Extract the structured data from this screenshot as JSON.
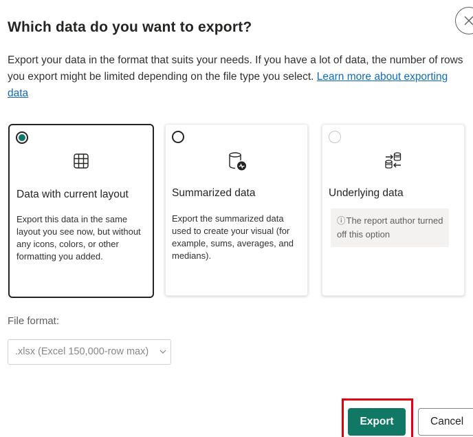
{
  "dialog": {
    "title": "Which data do you want to export?",
    "close_icon": "close-icon",
    "description": "Export your data in the format that suits your needs. If you have a lot of data, the number of rows you export might be limited depending on the file type you select.",
    "learn_more_link": "Learn more about exporting data"
  },
  "options": [
    {
      "title": "Data with current layout",
      "description": "Export this data in the same layout you see now, but without any icons, colors, or other formatting you added.",
      "icon": "table-grid-icon",
      "selected": true
    },
    {
      "title": "Summarized data",
      "description": "Export the summarized data used to create your visual (for example, sums, averages, and medians).",
      "icon": "database-chart-icon",
      "selected": false
    },
    {
      "title": "Underlying data",
      "note": "The report author turned off this option",
      "icon": "database-arrows-icon",
      "selected": false,
      "disabled": true
    }
  ],
  "file_format": {
    "label": "File format:",
    "value": ".xlsx (Excel 150,000-row max)"
  },
  "buttons": {
    "export": "Export",
    "cancel": "Cancel"
  },
  "colors": {
    "accent": "#117865",
    "link": "#0f6cbd",
    "highlight": "#e3000f"
  }
}
